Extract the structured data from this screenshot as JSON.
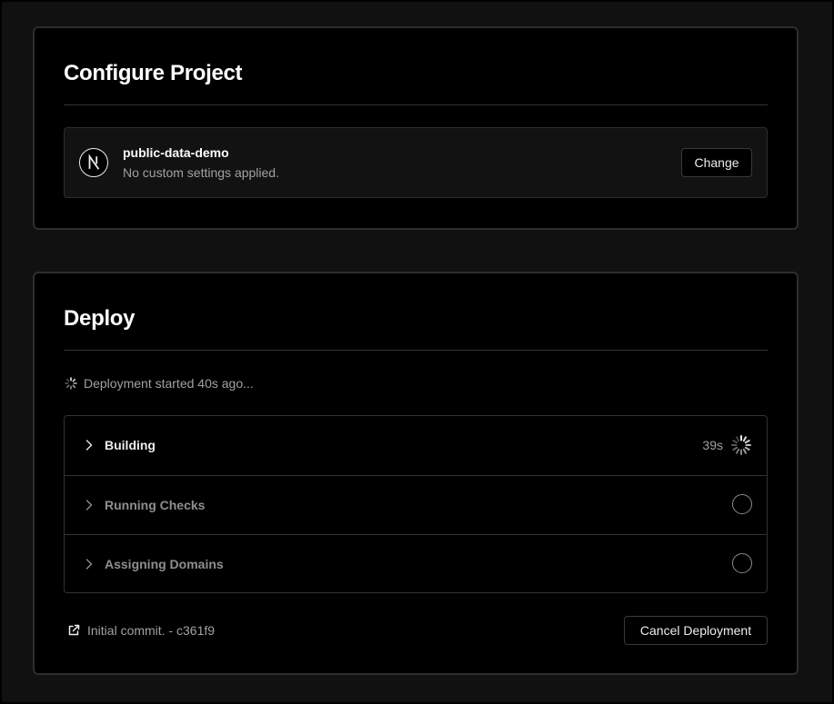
{
  "configure": {
    "title": "Configure Project",
    "project": {
      "icon": "nextjs-logo-icon",
      "name": "public-data-demo",
      "subtitle": "No custom settings applied.",
      "change_label": "Change"
    }
  },
  "deploy": {
    "title": "Deploy",
    "status_text": "Deployment started 40s ago...",
    "steps": [
      {
        "label": "Building",
        "time": "39s",
        "state": "in-progress"
      },
      {
        "label": "Running Checks",
        "time": "",
        "state": "pending"
      },
      {
        "label": "Assigning Domains",
        "time": "",
        "state": "pending"
      }
    ],
    "commit_text": "Initial commit. - c361f9",
    "cancel_label": "Cancel Deployment"
  },
  "colors": {
    "background": "#111111",
    "card": "#000000",
    "border": "#2e2e2e",
    "text_primary": "#ededed",
    "text_muted": "#a1a1a1"
  }
}
